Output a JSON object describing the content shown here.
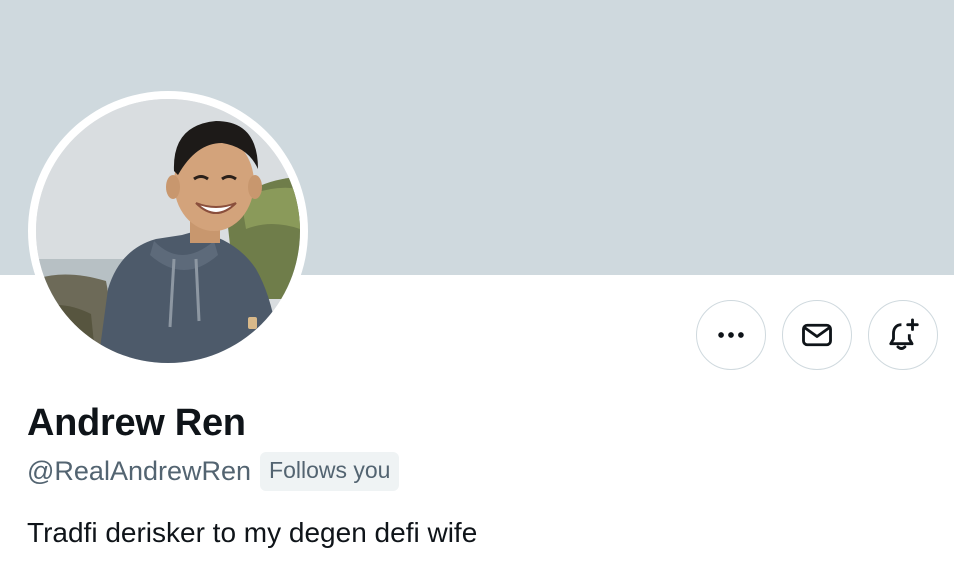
{
  "profile": {
    "display_name": "Andrew Ren",
    "handle": "@RealAndrewRen",
    "follows_you_badge": "Follows you",
    "bio": "Tradfi derisker to my degen defi wife"
  },
  "actions": [
    {
      "name": "more-options",
      "icon": "ellipsis-icon"
    },
    {
      "name": "message",
      "icon": "envelope-icon"
    },
    {
      "name": "notifications",
      "icon": "bell-plus-icon"
    }
  ],
  "colors": {
    "banner": "#cfd9de",
    "primary_text": "#0f1419",
    "secondary_text": "#536471",
    "badge_background": "#eff3f4",
    "button_border": "#cfd9de"
  }
}
